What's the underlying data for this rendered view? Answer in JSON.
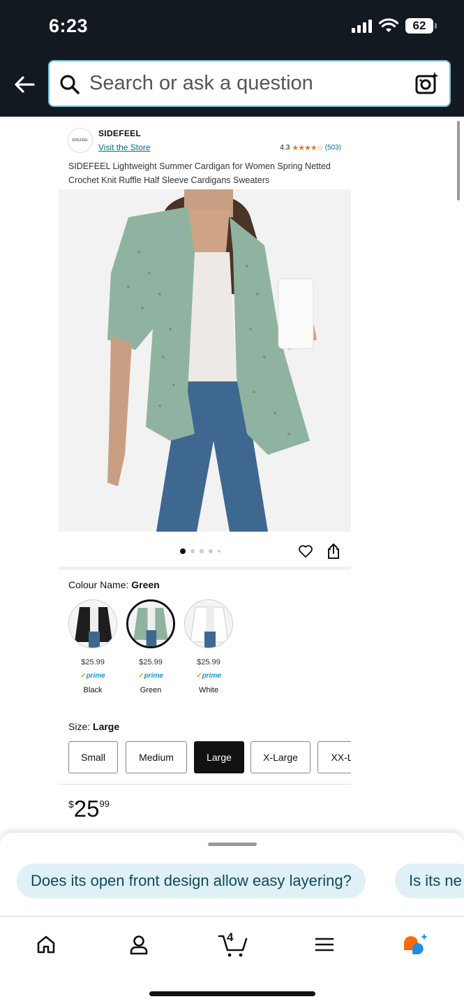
{
  "status_bar": {
    "time": "6:23",
    "battery": "62"
  },
  "search": {
    "placeholder": "Search or ask a question"
  },
  "product": {
    "brand": "SIDEFEEL",
    "logo_text": "SIDEFEEL",
    "visit_store": "Visit the Store",
    "rating": "4.3",
    "stars": "★★★★☆",
    "review_count": "(503)",
    "title": "SIDEFEEL Lightweight Summer Cardigan for Women Spring Netted Crochet Knit Ruffle Half Sleeve Cardigans Sweaters",
    "image_count": 5,
    "current_image": 1
  },
  "colour": {
    "label": "Colour Name: ",
    "selected": "Green",
    "options": [
      {
        "name": "Black",
        "price": "$25.99",
        "prime": "prime",
        "color": "#1e1e1e"
      },
      {
        "name": "Green",
        "price": "$25.99",
        "prime": "prime",
        "color": "#8fb3a0"
      },
      {
        "name": "White",
        "price": "$25.99",
        "prime": "prime",
        "color": "#f7f7f7"
      }
    ]
  },
  "size": {
    "label": "Size: ",
    "selected": "Large",
    "options": [
      "Small",
      "Medium",
      "Large",
      "X-Large",
      "XX-L"
    ]
  },
  "price": {
    "currency": "$",
    "whole": "25",
    "fraction": "99"
  },
  "suggestions": [
    "Does its open front design allow easy layering?",
    "Is its ne"
  ],
  "cart": {
    "count": "4"
  },
  "colors": {
    "header_bg": "#131921",
    "link": "#007185",
    "star": "#de7921",
    "prime": "#1399d2",
    "chip_bg": "#dff0f7"
  }
}
